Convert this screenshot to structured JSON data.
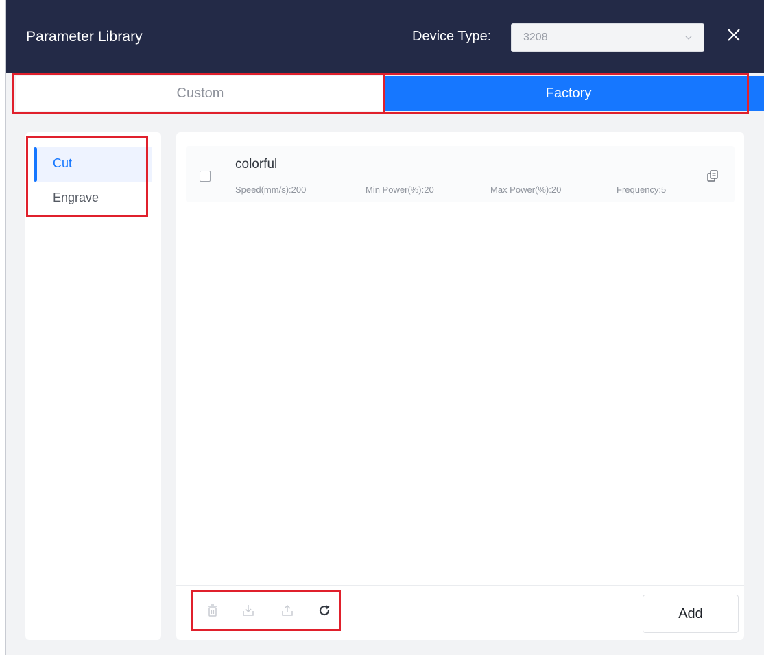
{
  "header": {
    "title": "Parameter Library",
    "device_type_label": "Device Type:",
    "device_type_value": "3208",
    "close_icon": "close-icon"
  },
  "tabs": [
    {
      "label": "Custom",
      "active": false
    },
    {
      "label": "Factory",
      "active": true
    }
  ],
  "sidebar": {
    "items": [
      {
        "label": "Cut",
        "active": true
      },
      {
        "label": "Engrave",
        "active": false
      }
    ]
  },
  "list": {
    "items": [
      {
        "name": "colorful",
        "speed": "Speed(mm/s):200",
        "min_power": "Min Power(%):20",
        "max_power": "Max Power(%):20",
        "frequency": "Frequency:5"
      }
    ]
  },
  "footer": {
    "tools": [
      "delete-icon",
      "import-icon",
      "export-icon",
      "refresh-icon"
    ],
    "add_label": "Add"
  },
  "colors": {
    "header_bg": "#232a47",
    "accent": "#1677ff",
    "highlight": "#e0202c"
  }
}
